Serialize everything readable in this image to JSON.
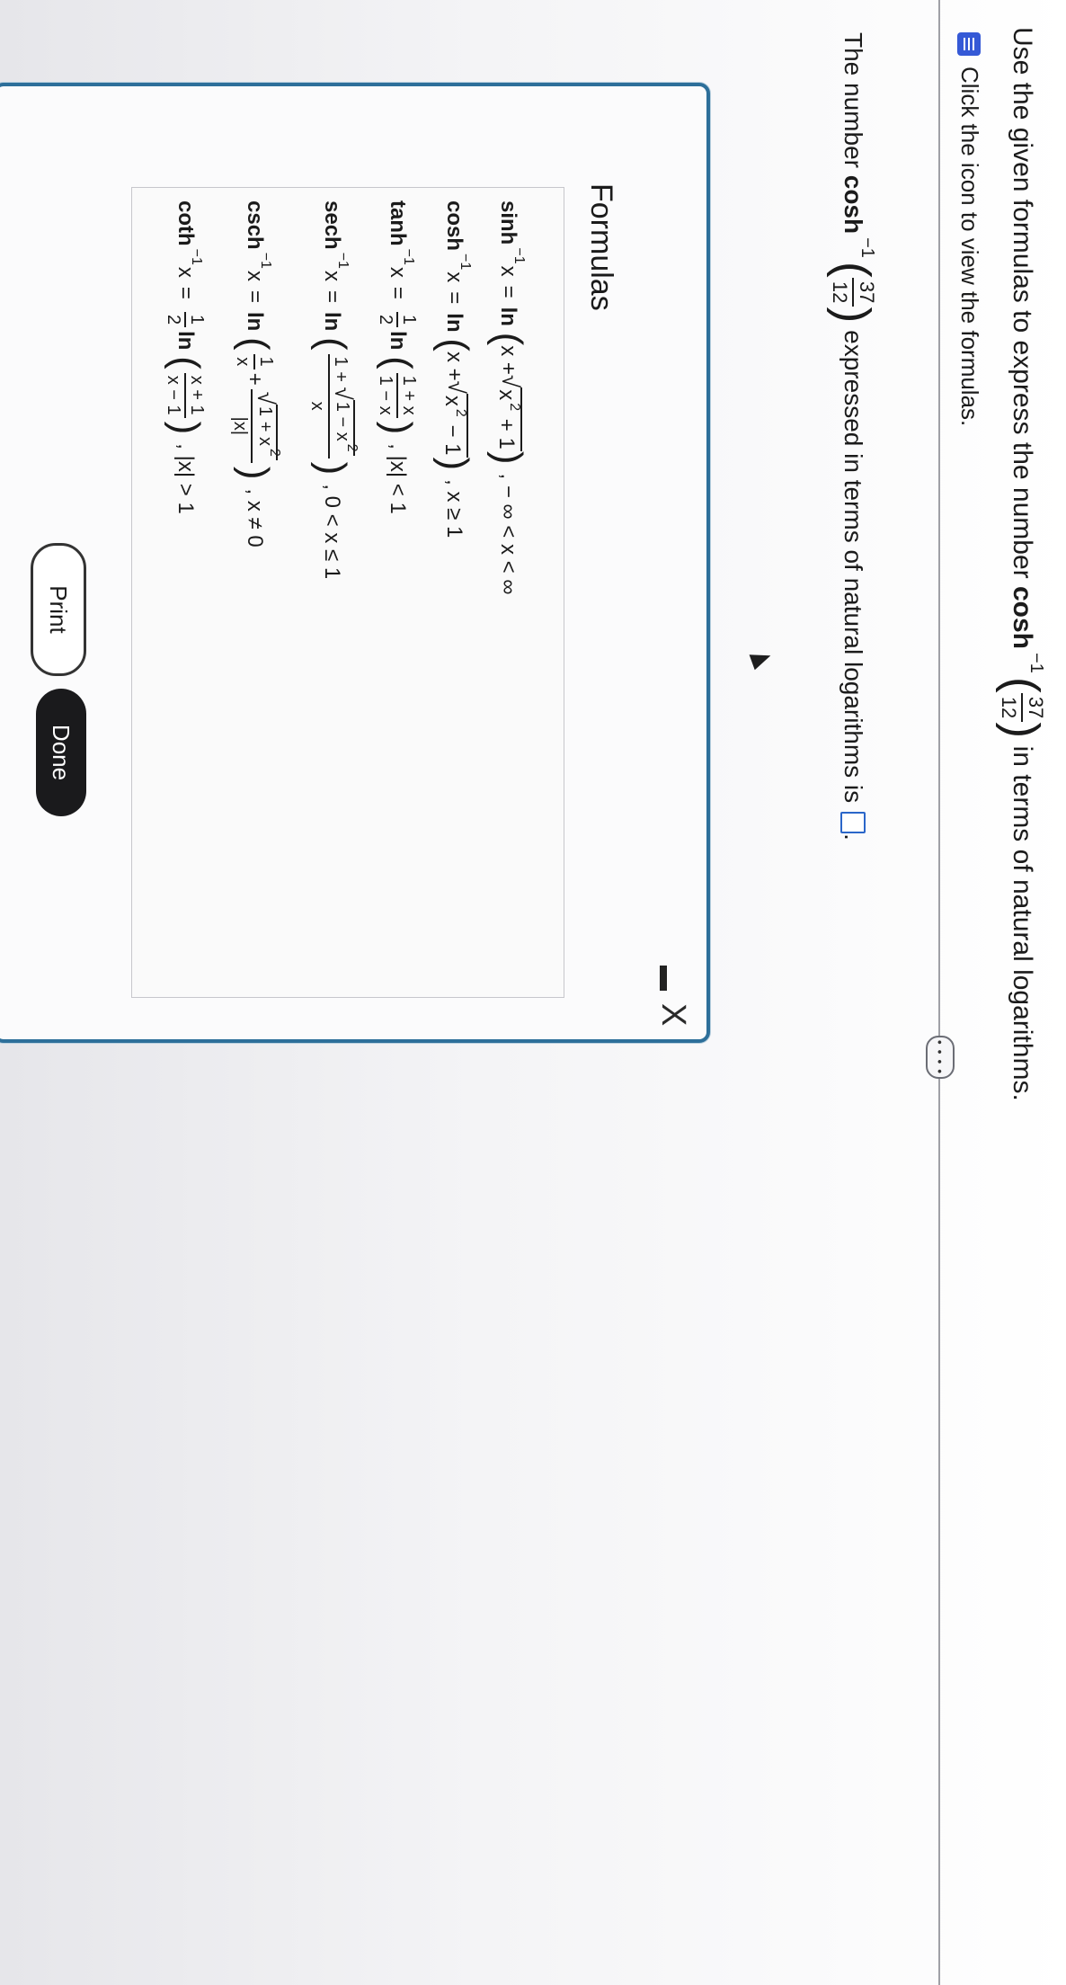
{
  "question": {
    "instruction_prefix": "Use the given formulas to express the number",
    "func": "cosh",
    "inverse_exp": "−1",
    "arg_num": "37",
    "arg_den": "12",
    "instruction_suffix": "in terms of natural logarithms.",
    "hint_text": "Click the icon to view the formulas.",
    "prompt_prefix": "The number",
    "prompt_suffix": "expressed in terms of natural logarithms is",
    "period": "."
  },
  "more_button": {
    "label": "• • • •"
  },
  "dialog": {
    "title": "Formulas",
    "close_glyph": "X",
    "formulas": [
      {
        "func": "sinh",
        "exp": "−1",
        "var": "x",
        "eq": "=",
        "body": "ln (x + √(x² + 1))",
        "cond": ", − ∞ < x < ∞"
      },
      {
        "func": "cosh",
        "exp": "−1",
        "var": "x",
        "eq": "=",
        "body": "ln (x + √(x² − 1))",
        "cond": ", x ≥ 1"
      },
      {
        "func": "tanh",
        "exp": "−1",
        "var": "x",
        "eq": "=",
        "coef": "1/2",
        "body": "ln ((1 + x)/(1 − x))",
        "cond": ", |x| < 1"
      },
      {
        "func": "sech",
        "exp": "−1",
        "var": "x",
        "eq": "=",
        "body": "ln ((1 + √(1 − x²))/x)",
        "cond": ", 0 < x ≤ 1"
      },
      {
        "func": "csch",
        "exp": "−1",
        "var": "x",
        "eq": "=",
        "body": "ln (1/x + √(1 + x²)/|x|)",
        "cond": ", x ≠ 0"
      },
      {
        "func": "coth",
        "exp": "−1",
        "var": "x",
        "eq": "=",
        "coef": "1/2",
        "body": "ln ((x + 1)/(x − 1))",
        "cond": ", |x| > 1"
      }
    ],
    "print_label": "Print",
    "done_label": "Done"
  },
  "colors": {
    "dialog_border": "#2d6f9a",
    "answer_box": "#2a66c9",
    "hint_icon": "#3559d6",
    "done_button": "#1a1a1c"
  },
  "icons": {
    "hint": "formula-icon",
    "close": "close-icon",
    "minimize": "minimize-icon"
  }
}
